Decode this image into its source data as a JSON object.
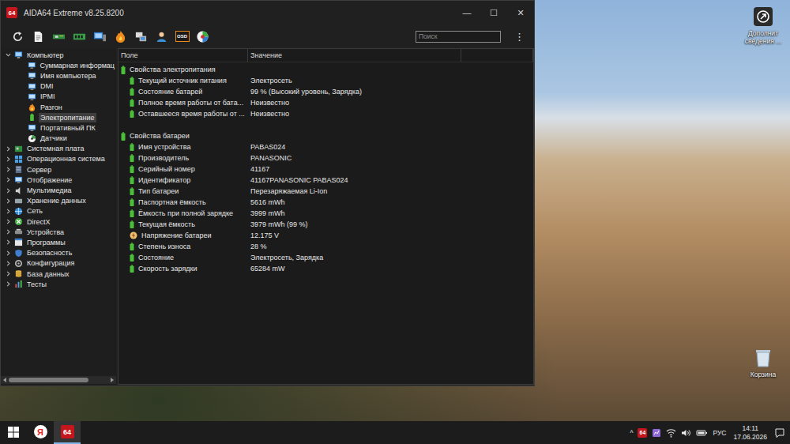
{
  "window": {
    "app_icon": "64",
    "title": "AIDA64 Extreme v8.25.8200",
    "controls": [
      "—",
      "☐",
      "✕"
    ]
  },
  "toolbar": {
    "osd_label": "OSD",
    "search": {
      "placeholder": "Поиск"
    },
    "menu": "⋮"
  },
  "tree": {
    "items": [
      {
        "label": "Компьютер",
        "expanded": true,
        "selected": false,
        "children": [
          {
            "label": "Суммарная информац",
            "selected": false
          },
          {
            "label": "Имя компьютера",
            "selected": false
          },
          {
            "label": "DMI",
            "selected": false
          },
          {
            "label": "IPMI",
            "selected": false
          },
          {
            "label": "Разгон",
            "selected": false
          },
          {
            "label": "Электропитание",
            "selected": true
          },
          {
            "label": "Портативный ПК",
            "selected": false
          },
          {
            "label": "Датчики",
            "selected": false
          }
        ]
      },
      {
        "label": "Системная плата",
        "expanded": false,
        "selected": false,
        "children": []
      },
      {
        "label": "Операционная система",
        "expanded": false,
        "selected": false,
        "children": []
      },
      {
        "label": "Сервер",
        "expanded": false,
        "selected": false,
        "children": []
      },
      {
        "label": "Отображение",
        "expanded": false,
        "selected": false,
        "children": []
      },
      {
        "label": "Мультимедиа",
        "expanded": false,
        "selected": false,
        "children": []
      },
      {
        "label": "Хранение данных",
        "expanded": false,
        "selected": false,
        "children": []
      },
      {
        "label": "Сеть",
        "expanded": false,
        "selected": false,
        "children": []
      },
      {
        "label": "DirectX",
        "expanded": false,
        "selected": false,
        "children": []
      },
      {
        "label": "Устройства",
        "expanded": false,
        "selected": false,
        "children": []
      },
      {
        "label": "Программы",
        "expanded": false,
        "selected": false,
        "children": []
      },
      {
        "label": "Безопасность",
        "expanded": false,
        "selected": false,
        "children": []
      },
      {
        "label": "Конфигурация",
        "expanded": false,
        "selected": false,
        "children": []
      },
      {
        "label": "База данных",
        "expanded": false,
        "selected": false,
        "children": []
      },
      {
        "label": "Тесты",
        "expanded": false,
        "selected": false,
        "children": []
      }
    ],
    "scrollbar": {
      "level": 0.8
    }
  },
  "table": {
    "columns": [
      "Поле",
      "Значение"
    ],
    "sections": [
      {
        "title": "Свойства электропитания",
        "rows": [
          {
            "field": "Текущий источник питания",
            "value": "Электросеть",
            "kind": "battery"
          },
          {
            "field": "Состояние батарей",
            "value": "99 % (Высокий уровень, Зарядка)",
            "kind": "battery"
          },
          {
            "field": "Полное время работы от бата...",
            "value": "Неизвестно",
            "kind": "battery"
          },
          {
            "field": "Оставшееся время работы от ...",
            "value": "Неизвестно",
            "kind": "battery"
          }
        ]
      },
      {
        "title": "Свойства батареи",
        "rows": [
          {
            "field": "Имя устройства",
            "value": "PABAS024",
            "kind": "battery"
          },
          {
            "field": "Производитель",
            "value": "PANASONIC",
            "kind": "battery"
          },
          {
            "field": "Серийный номер",
            "value": "41167",
            "kind": "battery"
          },
          {
            "field": "Идентификатор",
            "value": "41167PANASONIC PABAS024",
            "kind": "battery"
          },
          {
            "field": "Тип батареи",
            "value": "Перезаряжаемая Li-Ion",
            "kind": "battery"
          },
          {
            "field": "Паспортная ёмкость",
            "value": "5616 mWh",
            "kind": "battery"
          },
          {
            "field": "Ёмкость при полной зарядке",
            "value": "3999 mWh",
            "kind": "battery"
          },
          {
            "field": "Текущая ёмкость",
            "value": "3979 mWh  (99 %)",
            "kind": "battery"
          },
          {
            "field": "Напряжение батареи",
            "value": "12.175 V",
            "kind": "voltage"
          },
          {
            "field": "Степень износа",
            "value": "28 %",
            "kind": "battery"
          },
          {
            "field": "Состояние",
            "value": "Электросеть, Зарядка",
            "kind": "battery"
          },
          {
            "field": "Скорость зарядки",
            "value": "65284 mW",
            "kind": "battery"
          }
        ]
      }
    ]
  },
  "desktop": {
    "icons": [
      {
        "label": "Дополнит сведения ...",
        "kind": "info"
      },
      {
        "label": "Корзина",
        "kind": "bin"
      }
    ]
  },
  "taskbar": {
    "apps": [
      {
        "kind": "start",
        "selected": false
      },
      {
        "kind": "yandex",
        "label": "Я",
        "selected": false
      },
      {
        "kind": "aida",
        "label": "64",
        "selected": true
      }
    ],
    "tray": {
      "overflow": "^",
      "tray_app": "64",
      "language": "РУС",
      "time": "14:11",
      "date": "17.06.2026"
    }
  }
}
